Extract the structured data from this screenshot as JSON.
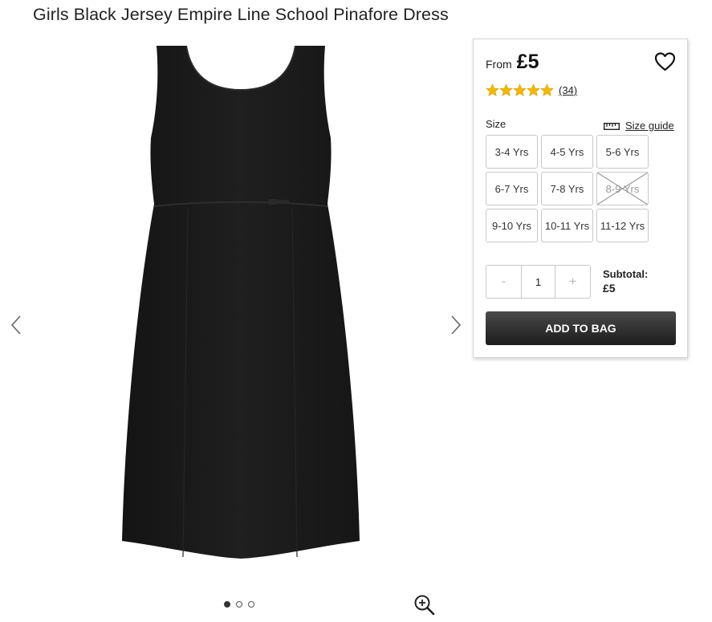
{
  "product": {
    "title": "Girls Black Jersey Empire Line School Pinafore Dress"
  },
  "gallery": {
    "slide_count": 3,
    "active_slide": 1
  },
  "purchase": {
    "from_label": "From",
    "price": "£5",
    "rating": 5,
    "rating_max": 5,
    "review_count": "(34)",
    "size_label": "Size",
    "size_guide_label": "Size guide",
    "sizes": [
      {
        "label": "3-4 Yrs",
        "available": true
      },
      {
        "label": "4-5 Yrs",
        "available": true
      },
      {
        "label": "5-6 Yrs",
        "available": true
      },
      {
        "label": "6-7 Yrs",
        "available": true
      },
      {
        "label": "7-8 Yrs",
        "available": true
      },
      {
        "label": "8-9 Yrs",
        "available": false
      },
      {
        "label": "9-10 Yrs",
        "available": true
      },
      {
        "label": "10-11 Yrs",
        "available": true
      },
      {
        "label": "11-12 Yrs",
        "available": true
      }
    ],
    "qty_minus": "-",
    "qty_value": "1",
    "qty_plus": "+",
    "subtotal_label": "Subtotal:",
    "subtotal_value": "£5",
    "add_to_bag": "ADD TO BAG"
  },
  "colors": {
    "star": "#f5b800",
    "button_dark": "#1c1c1c",
    "border": "#c8c8c8"
  },
  "icons": [
    "chevron-left-icon",
    "chevron-right-icon",
    "zoom-in-icon",
    "heart-icon",
    "star-icon",
    "ruler-icon",
    "cross-icon"
  ]
}
